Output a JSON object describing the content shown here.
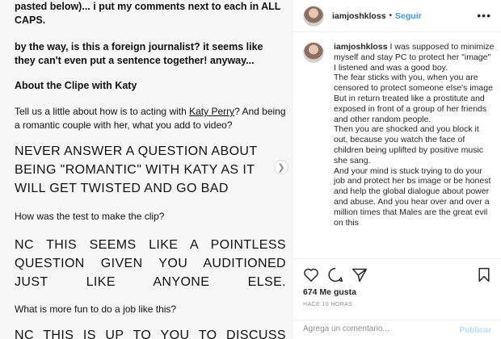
{
  "document": {
    "line1": "pasted below)... i put my comments next to each in ALL",
    "line1b": "CAPS.",
    "line2": "by the way, is this a foreign journalist? it seems like they can't even put a sentence together! anyway...",
    "heading": "About the Clipe with Katy",
    "question1_pre": "Tell us a little about how is to acting with ",
    "question1_link": "Katy Perry",
    "question1_post": "? And being a romantic couple with her, what you add to video?",
    "answer1": "NEVER ANSWER A QUESTION ABOUT BEING \"ROMANTIC\" WITH KATY AS IT WILL GET TWISTED AND GO BAD",
    "question2": "How was the test to make the clip?",
    "answer2": "NC THIS SEEMS LIKE A POINTLESS QUESTION GIVEN YOU AUDITIONED JUST LIKE ANYONE ELSE.",
    "question3": "What is more fun to do a job like this?",
    "answer3": "NC THIS IS UP TO YOU TO DISCUSS"
  },
  "post": {
    "username": "iamjoshkloss",
    "separator": "•",
    "follow_label": "Seguir",
    "more_label": "•••"
  },
  "comment": {
    "username": "iamjoshkloss",
    "paragraphs": [
      "I was supposed to minimize myself and stay PC to protect her \"image\"",
      "I listened and was a good boy.",
      "The fear sticks with you, when you are censored to protect someone else's image.",
      "But in return treated like a prostitute and exposed in front of a group of her friends and other random people.",
      "Then you are shocked and you block it out, because you watch the face of children being uplifted by positive music she sang.",
      "And your mind is stuck trying to do your job and protect her bs image or be honest and help the global dialogue about power and abuse. And you hear over and over a million times that Males are the great evil on this"
    ]
  },
  "stats": {
    "likes": "674 Me gusta",
    "time": "HACE 10 HORAS"
  },
  "add_comment": {
    "placeholder": "Agrega un comentario...",
    "publish_label": "Publicar"
  },
  "icons": [
    "heart-icon",
    "comment-icon",
    "share-icon",
    "bookmark-icon",
    "chevron-right-icon"
  ],
  "colors": {
    "link_blue": "#3897f0",
    "publish_disabled": "#b3dbff",
    "muted_gray": "#8e8e8e"
  }
}
